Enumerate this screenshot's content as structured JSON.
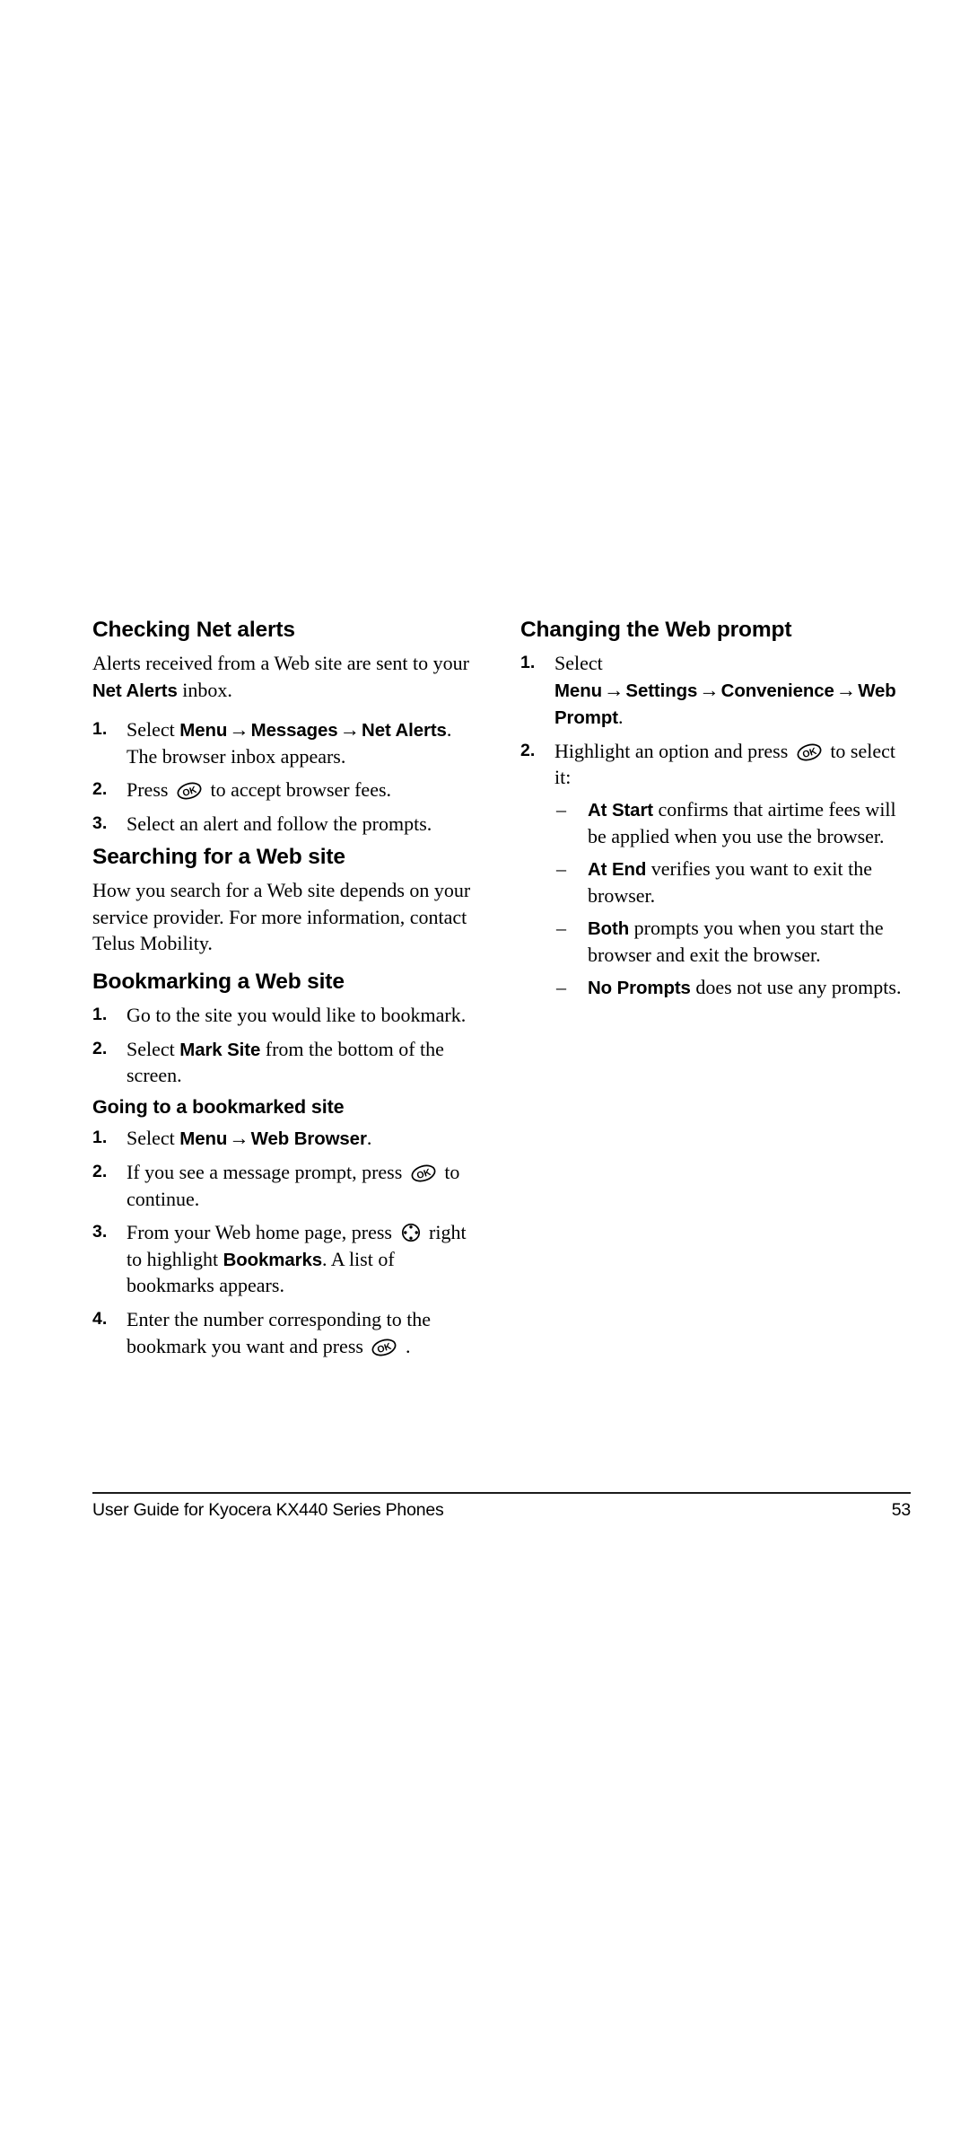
{
  "page": {
    "number": "53",
    "footer_text": "User Guide for Kyocera KX440 Series Phones"
  },
  "icons": {
    "ok_key": "ok-key-icon",
    "navigation_key": "navigation-key-icon"
  },
  "left_column": {
    "section1": {
      "heading": "Checking Net alerts",
      "intro_a": "Alerts received from a Web site are sent to your ",
      "intro_b": "Net Alerts",
      "intro_c": " inbox.",
      "steps": [
        {
          "num": "1.",
          "a": "Select ",
          "b1": "Menu",
          "ar1": "→",
          "b2": "Messages",
          "ar2": "→",
          "b3": "Net Alerts",
          "c": ". The browser inbox appears."
        },
        {
          "num": "2.",
          "a": "Press ",
          "c": " to accept browser fees."
        },
        {
          "num": "3.",
          "a": "Select an alert and follow the prompts."
        }
      ]
    },
    "section2": {
      "heading": "Searching for a Web site",
      "paragraph": "How you search for a Web site depends on your service provider. For more information, contact Telus Mobility."
    },
    "section3": {
      "heading": "Bookmarking a Web site",
      "steps": [
        {
          "num": "1.",
          "a": "Go to the site you would like to bookmark."
        },
        {
          "num": "2.",
          "a": "Select ",
          "b1": "Mark Site",
          "c": " from the bottom of the screen."
        }
      ]
    },
    "section4": {
      "heading": "Going to a bookmarked site",
      "steps": [
        {
          "num": "1.",
          "a": "Select ",
          "b1": "Menu",
          "ar1": "→",
          "b2": "Web Browser",
          "c": "."
        },
        {
          "num": "2.",
          "a": "If you see a message prompt, press ",
          "c": " to continue."
        },
        {
          "num": "3.",
          "a": "From your Web home page, press ",
          "c": " right to highlight ",
          "b1": "Bookmarks",
          "d": ". A list of bookmarks appears."
        },
        {
          "num": "4.",
          "a": "Enter the number corresponding to the bookmark you want and press ",
          "c": " ."
        }
      ]
    }
  },
  "right_column": {
    "section1": {
      "heading": "Changing the Web prompt",
      "steps": [
        {
          "num": "1.",
          "a": "Select ",
          "b1": "Menu",
          "ar1": "→",
          "b2": "Settings",
          "ar2": "→",
          "b3": "Convenience",
          "ar3": "→",
          "b4": "Web Prompt",
          "c": "."
        },
        {
          "num": "2.",
          "a": "Highlight an option and press ",
          "c": " to select it:"
        }
      ],
      "options": [
        {
          "dash": "–",
          "b": "At Start",
          "text": " confirms that airtime fees will be applied when you use the browser."
        },
        {
          "dash": "–",
          "b": "At End",
          "text": " verifies you want to exit the browser."
        },
        {
          "dash": "–",
          "b": "Both",
          "text": " prompts you when you start the browser and exit the browser."
        },
        {
          "dash": "–",
          "b": "No Prompts",
          "text": " does not use any prompts."
        }
      ]
    }
  }
}
